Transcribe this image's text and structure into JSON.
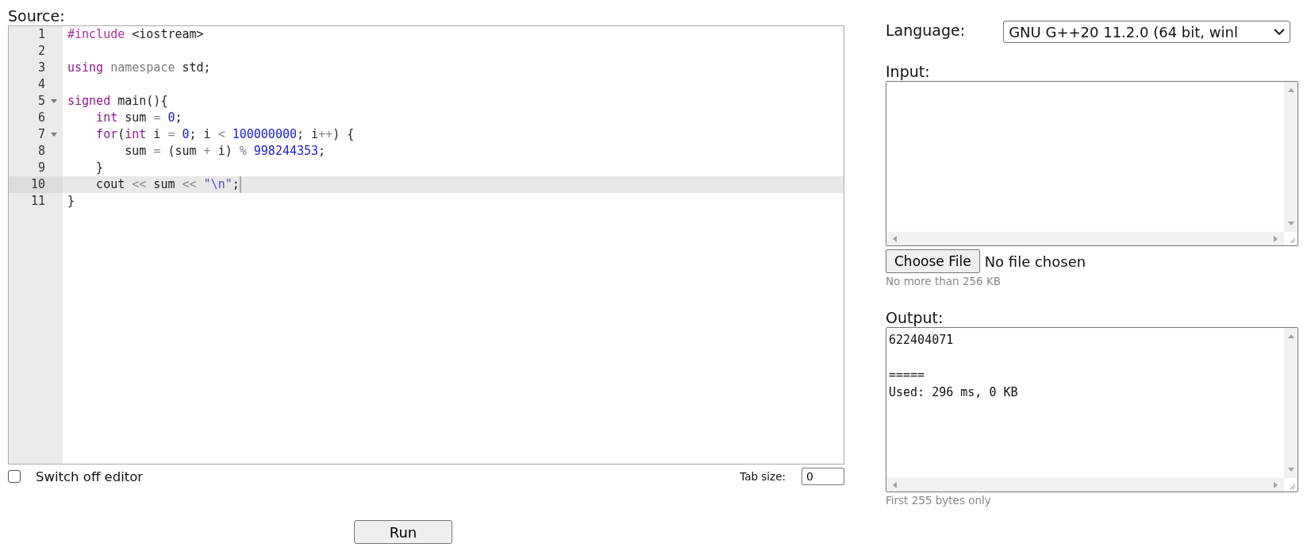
{
  "source": {
    "label": "Source:",
    "lines": [
      {
        "number": "1",
        "foldable": false,
        "active": false,
        "tokens": [
          {
            "text": "#include",
            "kind": "meta"
          },
          {
            "text": " <iostream>",
            "kind": "plain"
          }
        ]
      },
      {
        "number": "2",
        "foldable": false,
        "active": false
      },
      {
        "number": "3",
        "foldable": false,
        "active": false,
        "tokens": [
          {
            "text": "using ",
            "kind": "keyword"
          },
          {
            "text": "namespace",
            "kind": "def"
          },
          {
            "text": " std;",
            "kind": "plain"
          }
        ]
      },
      {
        "number": "4",
        "foldable": false,
        "active": false
      },
      {
        "number": "5",
        "foldable": true,
        "active": false,
        "tokens": [
          {
            "text": "signed",
            "kind": "keyword"
          },
          {
            "text": " main(){",
            "kind": "plain"
          }
        ]
      },
      {
        "number": "6",
        "foldable": false,
        "active": false,
        "tokens": [
          {
            "text": "    int",
            "kind": "keyword"
          },
          {
            "text": " sum ",
            "kind": "plain"
          },
          {
            "text": "= ",
            "kind": "operator"
          },
          {
            "text": "0",
            "kind": "number"
          },
          {
            "text": ";",
            "kind": "plain"
          }
        ]
      },
      {
        "number": "7",
        "foldable": true,
        "active": false,
        "tokens": [
          {
            "text": "    for",
            "kind": "keyword"
          },
          {
            "text": "(",
            "kind": "plain"
          },
          {
            "text": "int",
            "kind": "keyword"
          },
          {
            "text": " i ",
            "kind": "plain"
          },
          {
            "text": "= ",
            "kind": "operator"
          },
          {
            "text": "0",
            "kind": "number"
          },
          {
            "text": "; i ",
            "kind": "plain"
          },
          {
            "text": "< ",
            "kind": "operator"
          },
          {
            "text": "100000000",
            "kind": "number"
          },
          {
            "text": "; i",
            "kind": "plain"
          },
          {
            "text": "++",
            "kind": "operator"
          },
          {
            "text": ") {",
            "kind": "plain"
          }
        ]
      },
      {
        "number": "8",
        "foldable": false,
        "active": false,
        "tokens": [
          {
            "text": "        sum ",
            "kind": "plain"
          },
          {
            "text": "=",
            "kind": "operator"
          },
          {
            "text": " (sum ",
            "kind": "plain"
          },
          {
            "text": "+",
            "kind": "operator"
          },
          {
            "text": " i) ",
            "kind": "plain"
          },
          {
            "text": "% ",
            "kind": "operator"
          },
          {
            "text": "998244353",
            "kind": "number"
          },
          {
            "text": ";",
            "kind": "plain"
          }
        ]
      },
      {
        "number": "9",
        "foldable": false,
        "active": false,
        "tokens": [
          {
            "text": "    }",
            "kind": "plain"
          }
        ]
      },
      {
        "number": "10",
        "foldable": false,
        "active": true,
        "tokens": [
          {
            "text": "    cout ",
            "kind": "plain"
          },
          {
            "text": "<<",
            "kind": "operator"
          },
          {
            "text": " sum ",
            "kind": "plain"
          },
          {
            "text": "<< ",
            "kind": "operator"
          },
          {
            "text": "\"\\n\"",
            "kind": "string"
          },
          {
            "text": ";",
            "kind": "plain"
          }
        ]
      },
      {
        "number": "11",
        "foldable": false,
        "active": false,
        "tokens": [
          {
            "text": "}",
            "kind": "plain"
          }
        ]
      }
    ]
  },
  "switch_off_editor": {
    "label": "Switch off editor",
    "checked": false
  },
  "tab_size": {
    "label": "Tab size:",
    "value": "0"
  },
  "run_button": "Run",
  "language": {
    "label": "Language:",
    "value": "GNU G++20 11.2.0 (64 bit, winl"
  },
  "input": {
    "label": "Input:",
    "file_button": "Choose File",
    "file_status": "No file chosen",
    "hint": "No more than 256 KB"
  },
  "output": {
    "label": "Output:",
    "value": "622404071\n\n=====\nUsed: 296 ms, 0 KB",
    "hint": "First 255 bytes only"
  }
}
